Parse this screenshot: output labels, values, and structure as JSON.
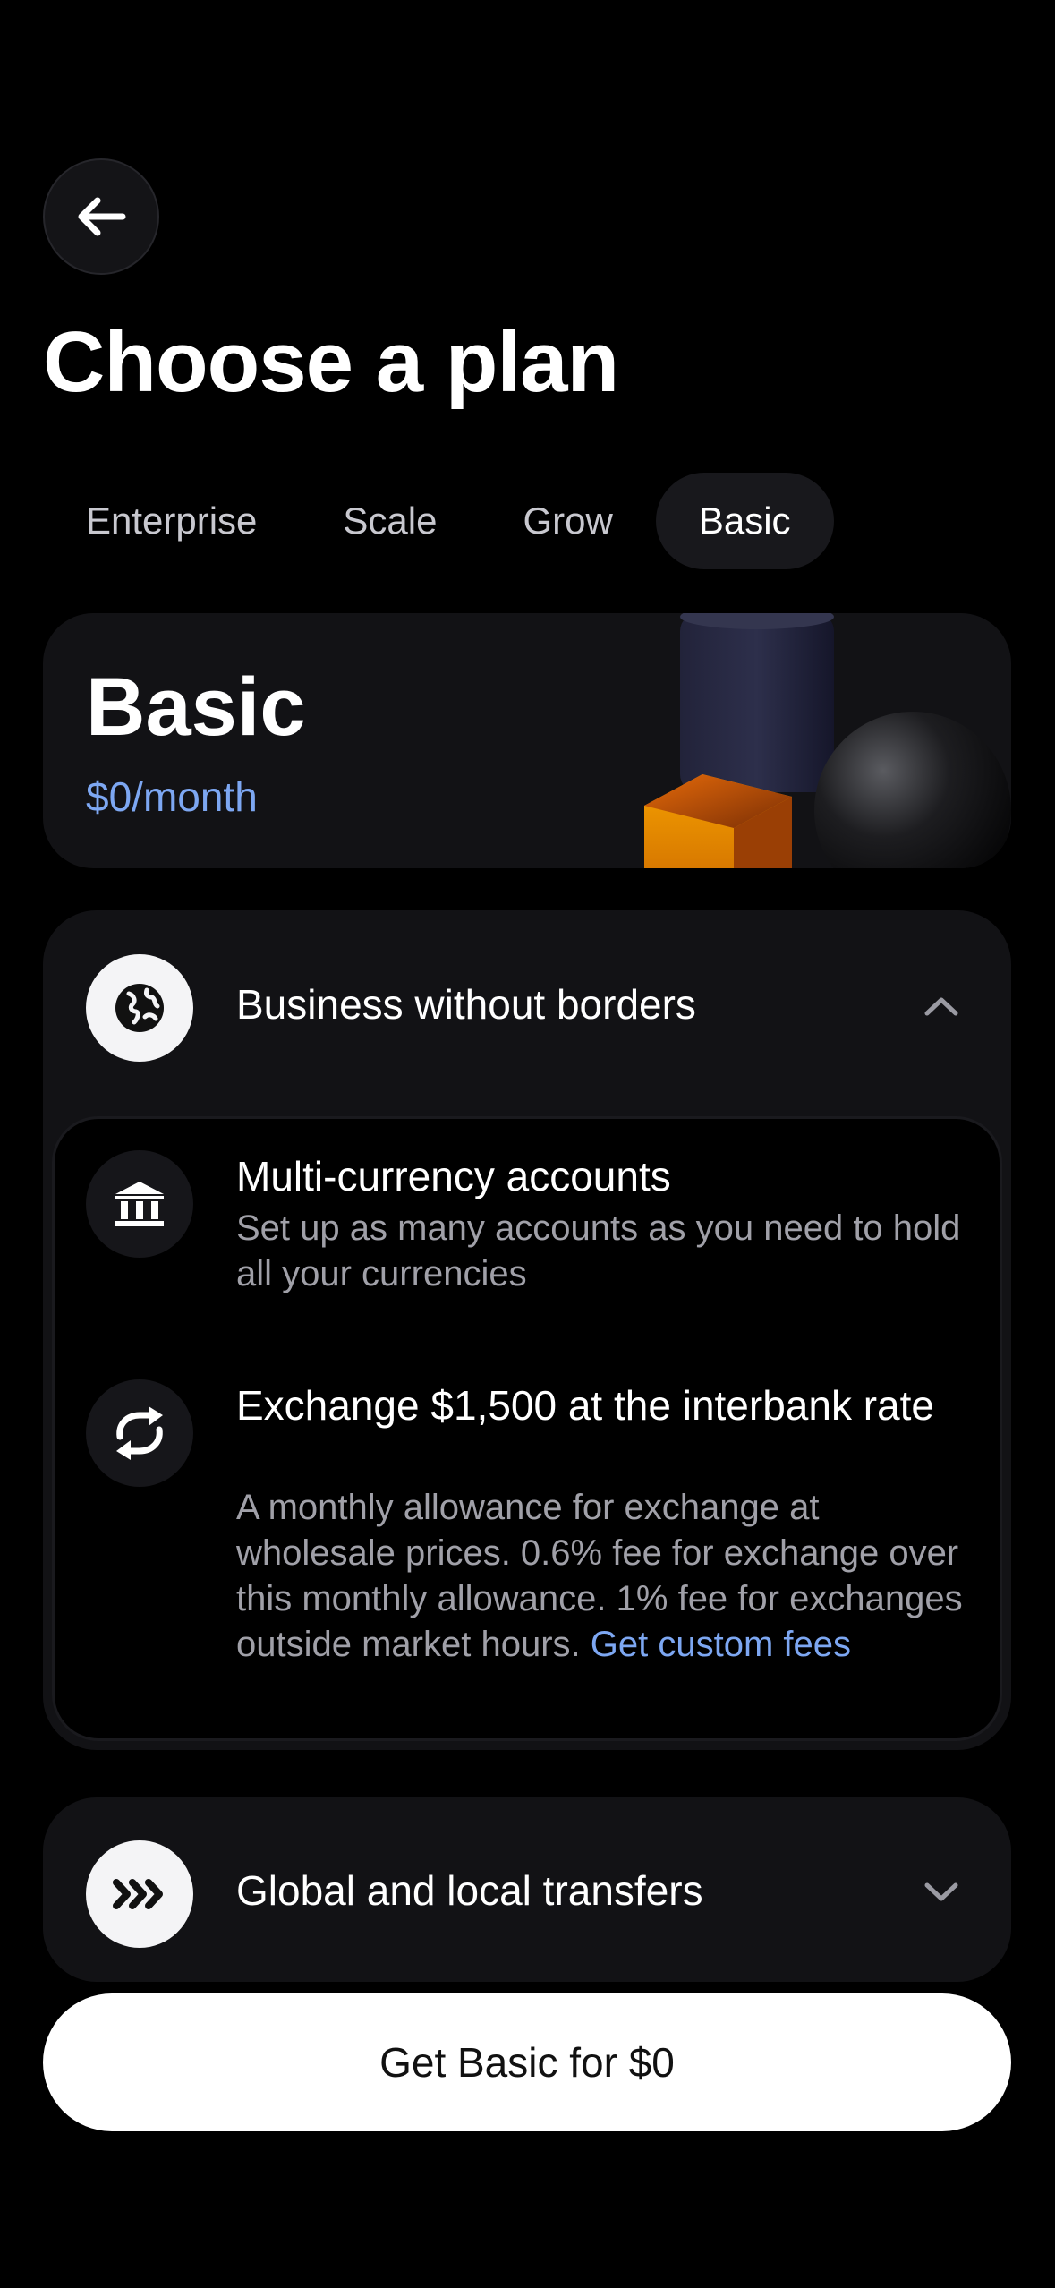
{
  "header": {
    "title": "Choose a plan"
  },
  "tabs": [
    {
      "label": "Enterprise",
      "active": false
    },
    {
      "label": "Scale",
      "active": false
    },
    {
      "label": "Grow",
      "active": false
    },
    {
      "label": "Basic",
      "active": true
    }
  ],
  "plan": {
    "name": "Basic",
    "price": "$0/month"
  },
  "sections": [
    {
      "title": "Business without borders",
      "icon": "globe-icon",
      "expanded": true,
      "features": [
        {
          "icon": "bank-icon",
          "title": "Multi-currency accounts",
          "description": "Set up as many accounts as you need to hold all your currencies"
        },
        {
          "icon": "exchange-icon",
          "title": "Exchange $1,500 at the interbank rate",
          "description": "A monthly allowance for exchange at wholesale prices. 0.6% fee for exchange over this monthly allowance. 1% fee for exchanges outside market hours.",
          "link": "Get custom fees"
        }
      ]
    },
    {
      "title": "Global and local transfers",
      "icon": "transfers-icon",
      "expanded": false
    }
  ],
  "cta": {
    "label": "Get Basic for $0"
  },
  "colors": {
    "accent": "#7da7f2",
    "background": "#000000",
    "card": "#121215"
  }
}
